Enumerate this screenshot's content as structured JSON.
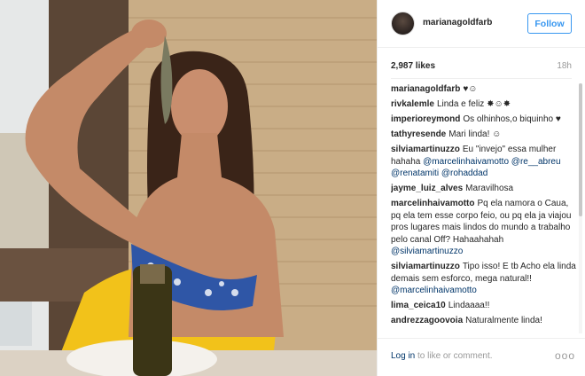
{
  "post": {
    "username": "marianagoldfarb",
    "follow_label": "Follow",
    "likes": "2,987 likes",
    "time": "18h"
  },
  "comments": [
    {
      "user": "marianagoldfarb",
      "text": "♥☺"
    },
    {
      "user": "rivkalemle",
      "text": "Linda e feliz ✸☺✸"
    },
    {
      "user": "imperioreymond",
      "text": "Os olhinhos,o biquinho ♥"
    },
    {
      "user": "tathyresende",
      "text": "Mari linda! ☺"
    },
    {
      "user": "silviamartinuzzo",
      "text": "Eu \"invejo\" essa mulher hahaha",
      "mentions": [
        "@marcelinhaivamotto",
        "@re__abreu",
        "@renatamiti",
        "@rohaddad"
      ]
    },
    {
      "user": "jayme_luiz_alves",
      "text": "Maravilhosa"
    },
    {
      "user": "marcelinhaivamotto",
      "text": "Pq ela namora o Caua, pq ela tem esse corpo feio, ou pq ela ja viajou pros lugares mais lindos do mundo a trabalho pelo canal Off? Hahaahahah",
      "mentions": [
        "@silviamartinuzzo"
      ]
    },
    {
      "user": "silviamartinuzzo",
      "text": "Tipo isso! E tb Acho ela linda demais sem esforco, mega natural!!",
      "mentions": [
        "@marcelinhaivamotto"
      ]
    },
    {
      "user": "lima_ceica10",
      "text": "Lindaaaa!!"
    },
    {
      "user": "andrezzagoovoia",
      "text": "Naturalmente linda!"
    }
  ],
  "footer": {
    "login_link": "Log in",
    "login_rest": " to like or comment.",
    "more_icon": "ellipsis-icon",
    "more_glyph": "ooo"
  },
  "colors": {
    "accent": "#3897f0",
    "link": "#003569",
    "muted": "#999999"
  }
}
